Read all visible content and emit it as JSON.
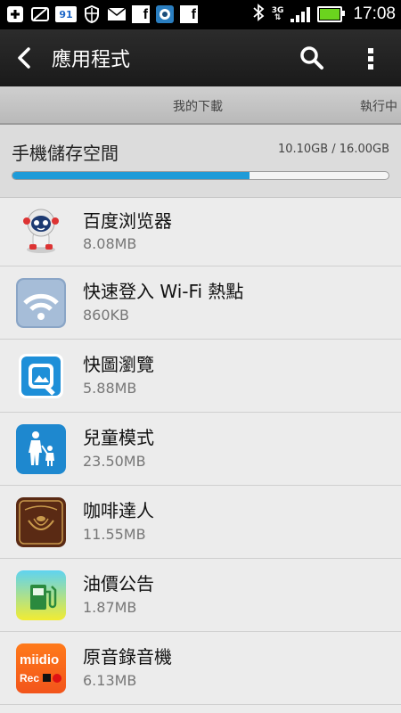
{
  "statusbar": {
    "time": "17:08",
    "network": "3G",
    "badge_number": "91",
    "fb_letter": "f"
  },
  "appbar": {
    "title": "應用程式"
  },
  "tabs": [
    {
      "label": "我的下載"
    },
    {
      "label": "執行中"
    }
  ],
  "storage": {
    "title": "手機儲存空間",
    "value": "10.10GB / 16.00GB",
    "used_fraction": 0.631
  },
  "apps": [
    {
      "name": "百度浏览器",
      "size": "8.08MB",
      "icon": "astronaut-icon"
    },
    {
      "name": "快速登入 Wi-Fi 熱點",
      "size": "860KB",
      "icon": "wifi-icon"
    },
    {
      "name": "快圖瀏覽",
      "size": "5.88MB",
      "icon": "photo-viewer-icon"
    },
    {
      "name": "兒童模式",
      "size": "23.50MB",
      "icon": "kid-mode-icon"
    },
    {
      "name": "咖啡達人",
      "size": "11.55MB",
      "icon": "coffee-icon"
    },
    {
      "name": "油價公告",
      "size": "1.87MB",
      "icon": "gas-pump-icon"
    },
    {
      "name": "原音錄音機",
      "size": "6.13MB",
      "icon": "miidio-recorder-icon",
      "icon_text": "miidio",
      "icon_subtext": "Rec"
    }
  ],
  "colors": {
    "accent": "#1e9bd8",
    "appbar": "#222222",
    "background": "#ececec"
  }
}
